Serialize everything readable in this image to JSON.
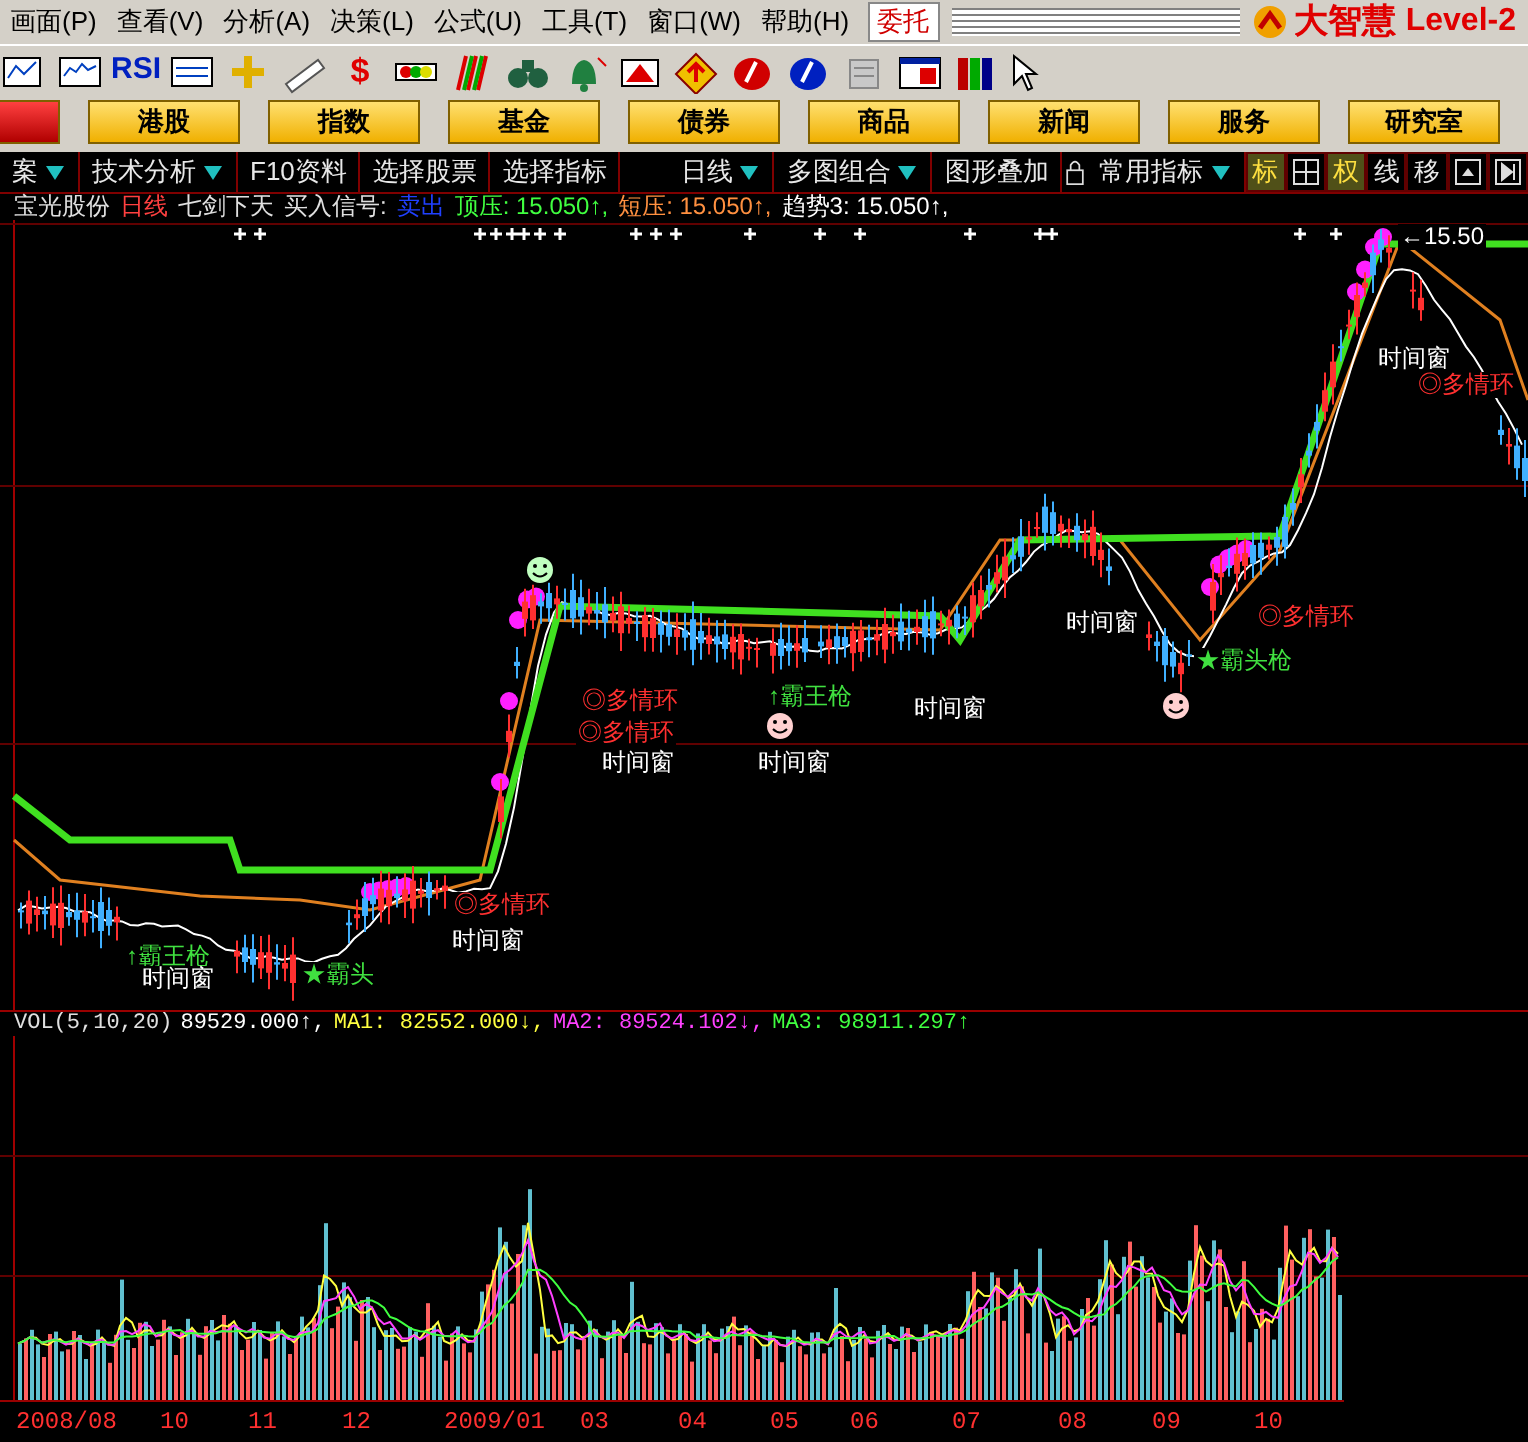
{
  "menu": [
    {
      "label": "画面(P)"
    },
    {
      "label": "查看(V)"
    },
    {
      "label": "分析(A)"
    },
    {
      "label": "决策(L)"
    },
    {
      "label": "公式(U)"
    },
    {
      "label": "工具(T)"
    },
    {
      "label": "窗口(W)"
    },
    {
      "label": "帮助(H)"
    }
  ],
  "trade_button": "委托",
  "logo": {
    "name": "大智慧",
    "edition": "Level-2"
  },
  "toolbar": {
    "rsi_label": "RSI",
    "dollar_label": "$"
  },
  "nav_buttons": [
    {
      "kind": "cut"
    },
    {
      "label": "港股",
      "kind": "normal"
    },
    {
      "label": "指数",
      "kind": "normal"
    },
    {
      "label": "基金",
      "kind": "normal"
    },
    {
      "label": "债券",
      "kind": "normal"
    },
    {
      "label": "商品",
      "kind": "normal"
    },
    {
      "label": "新闻",
      "kind": "normal"
    },
    {
      "label": "服务",
      "kind": "normal"
    },
    {
      "label": "研究室",
      "kind": "normal"
    }
  ],
  "chart_toolbar": [
    {
      "label": "案",
      "dropdown": true
    },
    {
      "label": "技术分析",
      "dropdown": true
    },
    {
      "label": "F10资料",
      "dropdown": false
    },
    {
      "label": "选择股票",
      "dropdown": false
    },
    {
      "label": "选择指标",
      "dropdown": false
    },
    {
      "label": "日线",
      "dropdown": true
    },
    {
      "label": "多图组合",
      "dropdown": true
    },
    {
      "label": "图形叠加",
      "dropdown": false
    },
    {
      "label": "常用指标",
      "dropdown": true
    }
  ],
  "view_buttons": [
    {
      "label": "标",
      "selected": true
    },
    {
      "label": "权",
      "selected": true
    },
    {
      "label": "线",
      "selected": false
    },
    {
      "label": "移",
      "selected": false
    }
  ],
  "info_line": [
    {
      "text": "宝光股份",
      "color": "#e0e0e0"
    },
    {
      "text": "日线",
      "color": "#ff4040"
    },
    {
      "text": "七剑下天",
      "color": "#e0e0e0"
    },
    {
      "text": "买入信号:",
      "color": "#e0e0e0"
    },
    {
      "text": "卖出",
      "color": "#2040ff"
    },
    {
      "text": "顶压: 15.050↑,",
      "color": "#40ff40"
    },
    {
      "text": "短压: 15.050↑,",
      "color": "#ff9040"
    },
    {
      "text": "趋势3: 15.050↑,",
      "color": "#ffffff"
    }
  ],
  "annotations": [
    {
      "text": "←15.50",
      "kind": "price"
    },
    {
      "text": "时间窗",
      "kind": "window"
    },
    {
      "text": "◎多情环",
      "kind": "ring"
    },
    {
      "text": "时间窗",
      "kind": "window"
    },
    {
      "text": "◎多情环",
      "kind": "ring"
    },
    {
      "text": "★霸头枪",
      "kind": "gun"
    },
    {
      "text": "◎多情环",
      "kind": "ring"
    },
    {
      "text": "↑霸王枪",
      "kind": "gun"
    },
    {
      "text": "时间窗",
      "kind": "window"
    },
    {
      "text": "◎多情环",
      "kind": "ring"
    },
    {
      "text": "时间窗",
      "kind": "window"
    },
    {
      "text": "时间窗",
      "kind": "window"
    },
    {
      "text": "◎多情环",
      "kind": "ring"
    },
    {
      "text": "时间窗",
      "kind": "window"
    },
    {
      "text": "↑霸王枪",
      "kind": "gun"
    },
    {
      "text": "时间窗",
      "kind": "window"
    },
    {
      "text": "★霸头",
      "kind": "gun"
    }
  ],
  "volume_line": [
    {
      "text": "VOL(5,10,20)",
      "color": "#e0e0e0"
    },
    {
      "text": "89529.000↑,",
      "color": "#ffffff"
    },
    {
      "text": "MA1: 82552.000↓,",
      "color": "#ffff40"
    },
    {
      "text": "MA2: 89524.102↓,",
      "color": "#ff40ff"
    },
    {
      "text": "MA3: 98911.297↑",
      "color": "#40ff40"
    }
  ],
  "date_axis": [
    "2008/08",
    "10",
    "11",
    "12",
    "2009/01",
    "03",
    "04",
    "05",
    "06",
    "07",
    "08",
    "09",
    "10"
  ]
}
